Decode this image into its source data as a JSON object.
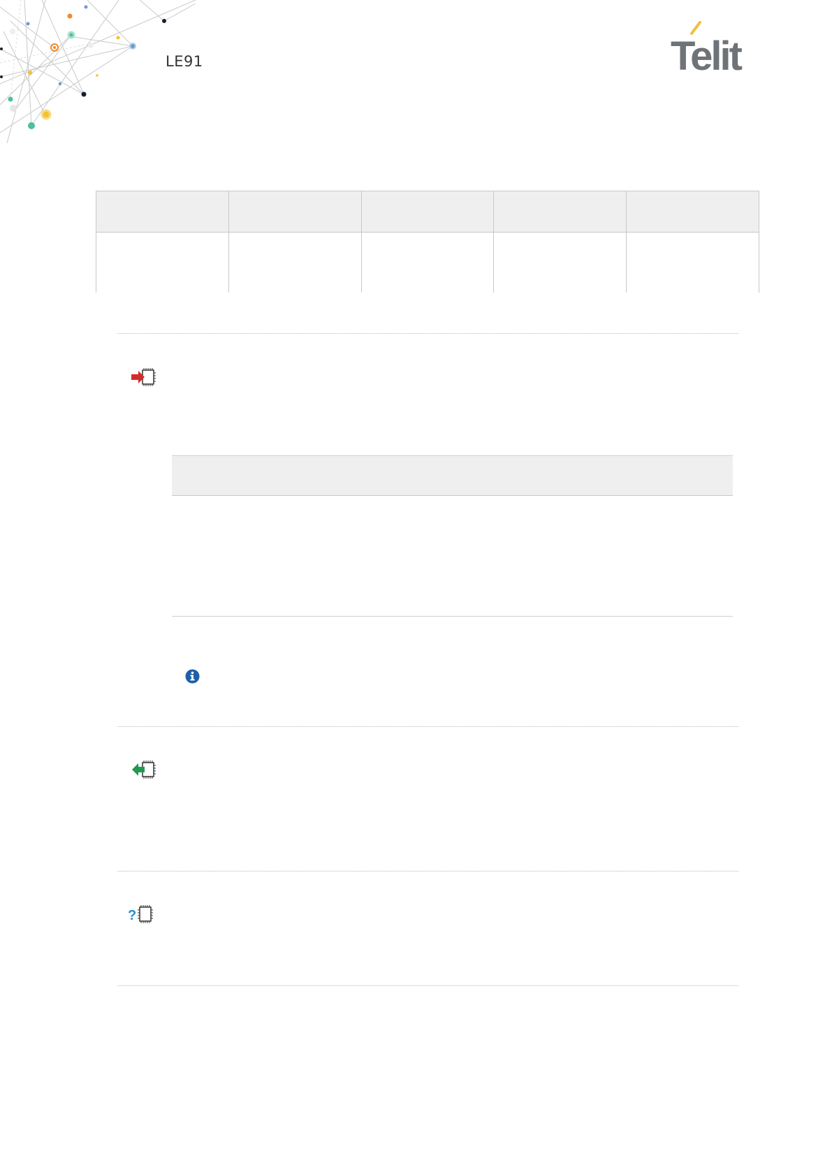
{
  "header": {
    "model": "LE91",
    "brand": "Telit"
  },
  "summary_table": {
    "columns": [
      "",
      "",
      "",
      "",
      ""
    ],
    "rows": [
      [
        "",
        "",
        "",
        "",
        ""
      ]
    ]
  },
  "sections": [
    {
      "icon": "set-command-icon",
      "arrow_color": "#d42b2b"
    },
    {
      "icon": "read-command-icon",
      "arrow_color": "#1f9a4f"
    },
    {
      "icon": "test-command-icon",
      "accent_color": "#2a8fc9"
    }
  ],
  "note": {
    "icon": "info-icon",
    "color": "#1e5fa8"
  },
  "colors": {
    "table_header": "#efefef",
    "table_border": "#c8c8c8",
    "logo_gray": "#6e7378",
    "logo_accent": "#f0c040"
  }
}
